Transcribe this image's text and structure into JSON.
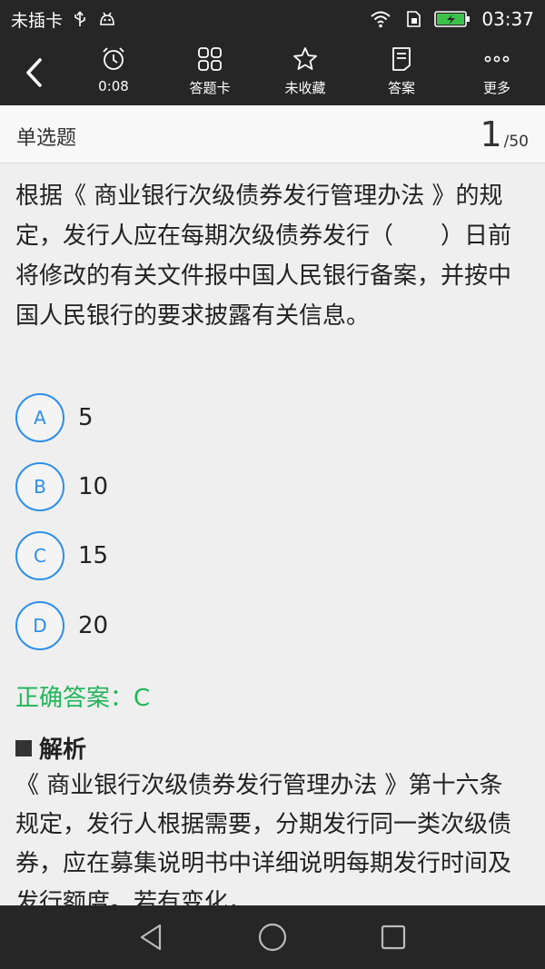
{
  "status_bar": {
    "carrier": "未插卡",
    "time": "03:37",
    "colors": {
      "battery": "#3cc24a"
    }
  },
  "toolbar": {
    "items": [
      {
        "icon": "alarm-clock-icon",
        "label": "0:08"
      },
      {
        "icon": "grid-icon",
        "label": "答题卡"
      },
      {
        "icon": "star-icon",
        "label": "未收藏"
      },
      {
        "icon": "document-icon",
        "label": "答案"
      },
      {
        "icon": "more-dots-icon",
        "label": "更多"
      }
    ]
  },
  "question_header": {
    "type": "单选题",
    "current": "1",
    "total": "/50"
  },
  "question": {
    "text": "根据《 商业银行次级债券发行管理办法 》的规定，发行人应在每期次级债券发行（　　）日前将修改的有关文件报中国人民银行备案，并按中国人民银行的要求披露有关信息。",
    "options": [
      {
        "letter": "A",
        "text": "5"
      },
      {
        "letter": "B",
        "text": "10"
      },
      {
        "letter": "C",
        "text": "15"
      },
      {
        "letter": "D",
        "text": "20"
      }
    ]
  },
  "answer": {
    "text": "正确答案：C",
    "color": "#22b55a"
  },
  "analysis": {
    "title": "解析",
    "text": "《 商业银行次级债券发行管理办法 》第十六条规定，发行人根据需要，分期发行同一类次级债券，应在募集说明书中详细说明每期发行时间及发行额度。若有变化，"
  },
  "colors": {
    "accent": "#2d8ee8",
    "bar": "#262626"
  }
}
